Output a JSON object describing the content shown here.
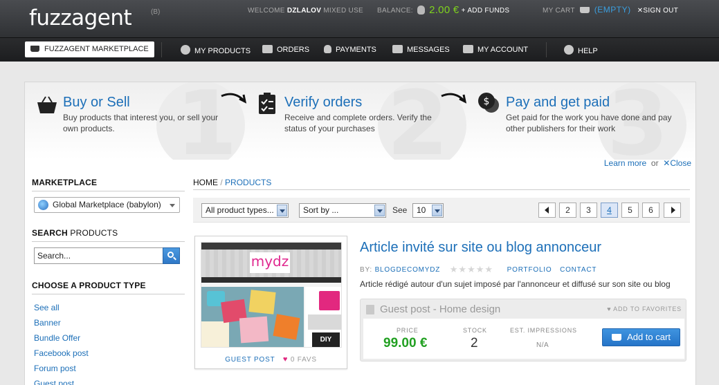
{
  "header": {
    "logo_text": "fuzzagent",
    "logo_badge": "(B)",
    "welcome_label": "WELCOME",
    "username": "DZLALOV",
    "mode": "MIXED USE",
    "balance_label": "BALANCE:",
    "balance_value": "2.00 €",
    "add_funds": "+ ADD FUNDS",
    "cart_label": "MY CART",
    "cart_status": "(EMPTY)",
    "sign_out": "SIGN OUT"
  },
  "nav": {
    "home": "FUZZAGENT MARKETPLACE",
    "items": [
      {
        "label": "MY PRODUCTS",
        "icon": "globe-icon"
      },
      {
        "label": "ORDERS",
        "icon": "basket-icon"
      },
      {
        "label": "PAYMENTS",
        "icon": "money-bag-icon"
      },
      {
        "label": "MESSAGES",
        "icon": "envelope-icon"
      },
      {
        "label": "MY ACCOUNT",
        "icon": "id-card-icon"
      },
      {
        "label": "HELP",
        "icon": "speech-bubble-icon"
      }
    ]
  },
  "hero": {
    "steps": [
      {
        "number": "1",
        "title": "Buy or Sell",
        "desc": "Buy products that interest you, or sell your own products.",
        "icon": "basket-icon"
      },
      {
        "number": "2",
        "title": "Verify orders",
        "desc": "Receive and complete orders. Verify the status of your purchases",
        "icon": "checklist-icon"
      },
      {
        "number": "3",
        "title": "Pay and get paid",
        "desc": "Get paid for the work you have done and pay other publishers for their work",
        "icon": "coins-icon"
      }
    ],
    "learn_more": "Learn more",
    "or": "or",
    "close": "Close"
  },
  "sidebar": {
    "marketplace_heading": "MARKETPLACE",
    "marketplace_selected": "Global Marketplace (babylon)",
    "search_heading_bold": "SEARCH",
    "search_heading_light": "PRODUCTS",
    "search_placeholder": "Search...",
    "product_type_heading": "CHOOSE A PRODUCT TYPE",
    "product_types": [
      "See all",
      "Banner",
      "Bundle Offer",
      "Facebook post",
      "Forum post",
      "Guest post"
    ]
  },
  "breadcrumb": {
    "home": "HOME",
    "separator": "/",
    "current": "PRODUCTS"
  },
  "toolbar": {
    "product_types": "All product types...",
    "sort_by": "Sort by ...",
    "see_label": "See",
    "per_page": "10",
    "pages": [
      "2",
      "3",
      "4",
      "5",
      "6"
    ],
    "active_page": "4"
  },
  "product": {
    "title": "Article invité sur site ou blog annonceur",
    "by_label": "BY:",
    "author": "BLOGDECOMYDZ",
    "stars": "★★★★★",
    "rating": 0,
    "portfolio": "PORTFOLIO",
    "contact": "CONTACT",
    "description": "Article rédigé autour d'un sujet imposé par l'annonceur et diffusé sur son site ou blog",
    "thumb_logo": "mydz",
    "thumb_diy": "DIY",
    "thumb_type": "GUEST POST",
    "favs": "0 FAVS",
    "offer": {
      "title": "Guest post - Home design",
      "add_to_favorites": "ADD TO FAVORITES",
      "price_label": "PRICE",
      "price": "99.00 €",
      "stock_label": "STOCK",
      "stock": "2",
      "impressions_label": "EST. IMPRESSIONS",
      "impressions": "N/A",
      "add_to_cart": "Add to cart"
    }
  },
  "colors": {
    "accent_blue": "#1c6fb8",
    "price_green": "#22a022",
    "balance_green": "#7fd21e",
    "heart_pink": "#e0287f"
  }
}
